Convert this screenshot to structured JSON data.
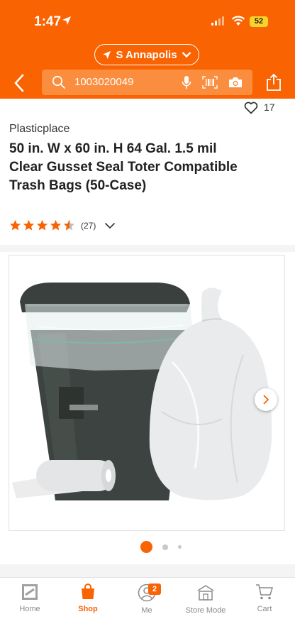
{
  "status_bar": {
    "time": "1:47",
    "battery": "52"
  },
  "header": {
    "store_name": "S Annapolis",
    "search_value": "1003020049"
  },
  "product": {
    "favorites_count": "17",
    "brand": "Plasticplace",
    "title": "50 in. W x 60 in. H 64 Gal. 1.5 mil Clear Gusset Seal Toter Compatible Trash Bags (50-Case)",
    "rating_value": 4.5,
    "review_count": "(27)"
  },
  "gallery": {
    "current_index": 1,
    "total_dots": 3
  },
  "bottom_nav": {
    "items": [
      {
        "label": "Home",
        "icon": "home-depot-logo-icon"
      },
      {
        "label": "Shop",
        "icon": "shopping-bag-icon"
      },
      {
        "label": "Me",
        "icon": "user-icon",
        "badge": "2"
      },
      {
        "label": "Store Mode",
        "icon": "store-icon"
      },
      {
        "label": "Cart",
        "icon": "cart-icon"
      }
    ],
    "active_label": "Shop"
  },
  "colors": {
    "brand_orange": "#f96302",
    "star": "#f96302"
  }
}
